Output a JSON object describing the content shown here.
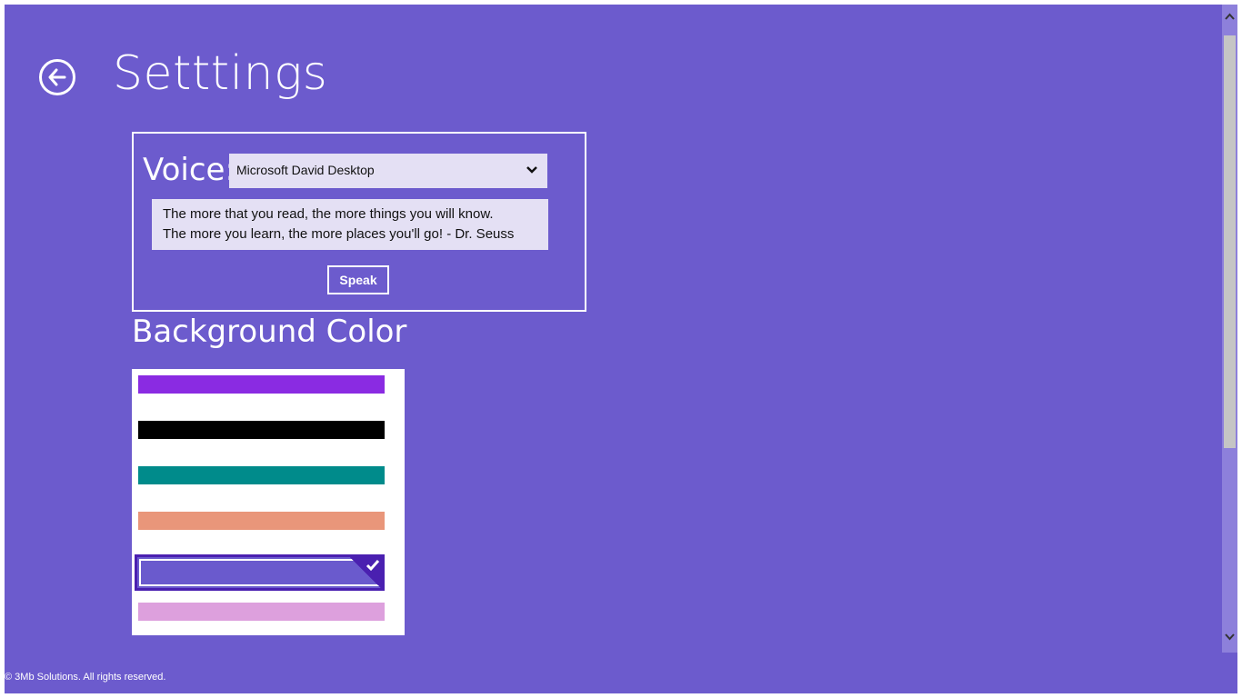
{
  "page": {
    "title": "Setttings",
    "back_icon": "back-arrow-icon"
  },
  "voice": {
    "label": "Voice:",
    "selected_voice": "Microsoft David Desktop",
    "dropdown_icon": "chevron-down-icon",
    "quote_line_1": "The more that you read, the more things you will know.",
    "quote_line_2": "The more you learn, the more places you'll go! - Dr. Seuss",
    "speak_label": "Speak"
  },
  "background_color": {
    "heading": "Background Color",
    "selected_index": 4,
    "swatches": [
      {
        "color": "#8a2be2"
      },
      {
        "color": "#000000"
      },
      {
        "color": "#008b8b"
      },
      {
        "color": "#e9967a"
      },
      {
        "color": "#6a5acd"
      },
      {
        "color": "#dda0dd"
      }
    ]
  },
  "scrollbar": {
    "up_icon": "chevron-up-icon",
    "down_icon": "chevron-down-icon"
  },
  "footer": {
    "copyright": "© 3Mb Solutions. All rights reserved."
  },
  "colors": {
    "app_background": "#6c5bcd",
    "panel_field": "#e4e0f4",
    "selection_border": "#4a20b0"
  }
}
